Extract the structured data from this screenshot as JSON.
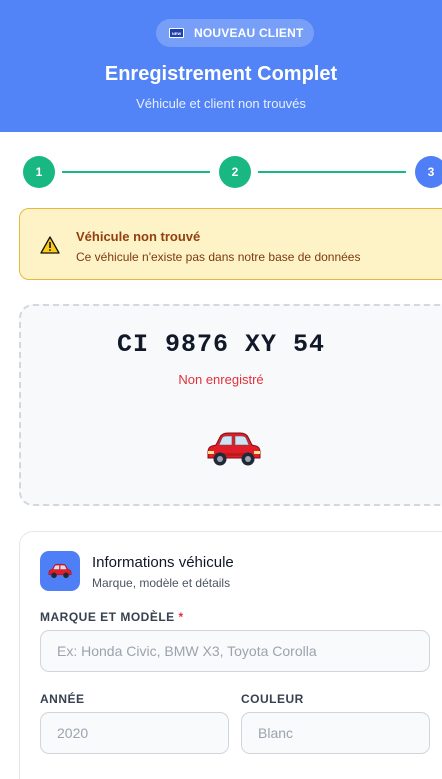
{
  "header": {
    "badge_label": "NOUVEAU CLIENT",
    "badge_icon": "new-icon",
    "title": "Enregistrement Complet",
    "subtitle": "Véhicule et client non trouvés"
  },
  "stepper": {
    "steps": [
      {
        "label": "1",
        "state": "done"
      },
      {
        "label": "2",
        "state": "done"
      },
      {
        "label": "3",
        "state": "active"
      }
    ]
  },
  "alert": {
    "icon": "warning-icon",
    "title": "Véhicule non trouvé",
    "text": "Ce véhicule n'existe pas dans notre base de données"
  },
  "plate": {
    "number": "CI 9876 XY 54",
    "status": "Non enregistré",
    "icon": "car-icon"
  },
  "vehicle_info": {
    "title": "Informations véhicule",
    "subtitle": "Marque, modèle et détails",
    "icon": "car-icon",
    "fields": {
      "make_model": {
        "label": "MARQUE ET MODÈLE",
        "required_mark": "*",
        "placeholder": "Ex: Honda Civic, BMW X3, Toyota Corolla",
        "value": ""
      },
      "year": {
        "label": "ANNÉE",
        "placeholder": "2020",
        "value": ""
      },
      "color": {
        "label": "COULEUR",
        "placeholder": "Blanc",
        "value": ""
      }
    }
  },
  "colors": {
    "header_bg": "#5284f7",
    "step_done": "#19b882",
    "step_active": "#4f7ff6",
    "alert_bg": "#fef3c7",
    "status_red": "#e0323b"
  }
}
